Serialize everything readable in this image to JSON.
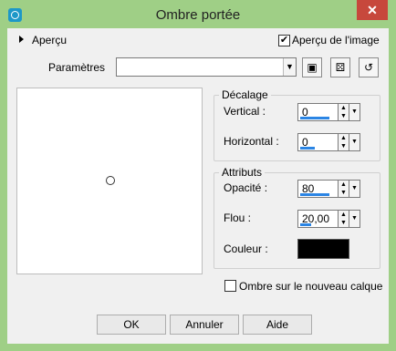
{
  "window": {
    "title": "Ombre portée"
  },
  "preview_section": {
    "label": "Aperçu"
  },
  "image_preview": {
    "label": "Aperçu de l'image",
    "checked": true
  },
  "presets": {
    "label": "Paramètres",
    "value": ""
  },
  "offset": {
    "title": "Décalage",
    "vertical_label": "Vertical :",
    "vertical_value": "0",
    "horizontal_label": "Horizontal :",
    "horizontal_value": "0"
  },
  "attributes": {
    "title": "Attributs",
    "opacity_label": "Opacité :",
    "opacity_value": "80",
    "opacity_fraction": 0.8,
    "blur_label": "Flou :",
    "blur_value": "20,00",
    "color_label": "Couleur :",
    "color_hex": "#000000"
  },
  "new_layer": {
    "label": "Ombre sur le nouveau calque",
    "checked": false
  },
  "buttons": {
    "ok": "OK",
    "cancel": "Annuler",
    "help": "Aide"
  }
}
